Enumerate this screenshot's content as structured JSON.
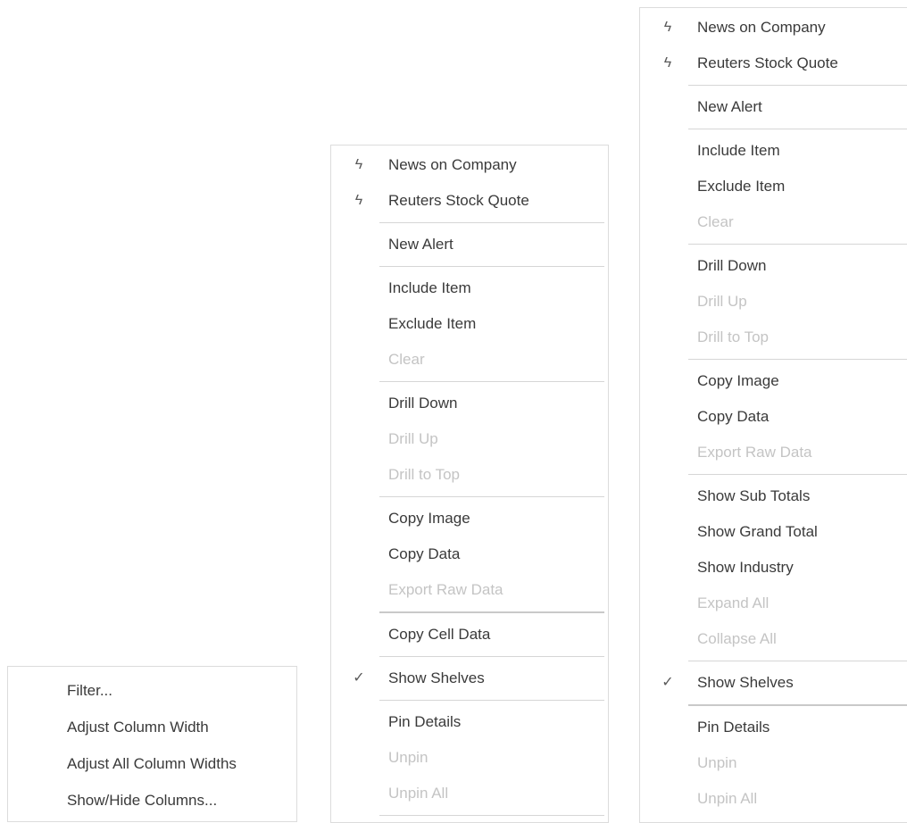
{
  "menus": {
    "left": {
      "items": [
        {
          "label": "Filter...",
          "disabled": false
        },
        {
          "label": "Adjust Column Width",
          "disabled": false
        },
        {
          "label": "Adjust All Column Widths",
          "disabled": false
        },
        {
          "label": "Show/Hide Columns...",
          "disabled": false
        }
      ]
    },
    "mid": {
      "items": [
        {
          "label": "News on Company",
          "icon": "bolt-icon",
          "disabled": false
        },
        {
          "label": "Reuters Stock Quote",
          "icon": "bolt-icon",
          "disabled": false
        },
        {
          "sep": true
        },
        {
          "label": "New Alert",
          "disabled": false
        },
        {
          "sep": true
        },
        {
          "label": "Include Item",
          "disabled": false
        },
        {
          "label": "Exclude Item",
          "disabled": false
        },
        {
          "label": "Clear",
          "disabled": true
        },
        {
          "sep": true
        },
        {
          "label": "Drill Down",
          "disabled": false
        },
        {
          "label": "Drill Up",
          "disabled": true
        },
        {
          "label": "Drill to Top",
          "disabled": true
        },
        {
          "sep": true
        },
        {
          "label": "Copy Image",
          "disabled": false
        },
        {
          "label": "Copy Data",
          "disabled": false
        },
        {
          "label": "Export Raw Data",
          "disabled": true
        },
        {
          "sep": true,
          "thick": true
        },
        {
          "label": "Copy Cell Data",
          "disabled": false
        },
        {
          "sep": true
        },
        {
          "label": "Show Shelves",
          "icon": "checkmark-icon",
          "disabled": false
        },
        {
          "sep": true
        },
        {
          "label": "Pin Details",
          "disabled": false
        },
        {
          "label": "Unpin",
          "disabled": true
        },
        {
          "label": "Unpin All",
          "disabled": true
        },
        {
          "sep": true
        }
      ]
    },
    "right": {
      "items": [
        {
          "label": "News on Company",
          "icon": "bolt-icon",
          "disabled": false
        },
        {
          "label": "Reuters Stock Quote",
          "icon": "bolt-icon",
          "disabled": false
        },
        {
          "sep": true
        },
        {
          "label": "New Alert",
          "disabled": false
        },
        {
          "sep": true
        },
        {
          "label": "Include Item",
          "disabled": false
        },
        {
          "label": "Exclude Item",
          "disabled": false
        },
        {
          "label": "Clear",
          "disabled": true
        },
        {
          "sep": true
        },
        {
          "label": "Drill Down",
          "disabled": false
        },
        {
          "label": "Drill Up",
          "disabled": true
        },
        {
          "label": "Drill to Top",
          "disabled": true
        },
        {
          "sep": true
        },
        {
          "label": "Copy Image",
          "disabled": false
        },
        {
          "label": "Copy Data",
          "disabled": false
        },
        {
          "label": "Export Raw Data",
          "disabled": true
        },
        {
          "sep": true
        },
        {
          "label": "Show Sub Totals",
          "disabled": false
        },
        {
          "label": "Show Grand Total",
          "disabled": false
        },
        {
          "label": "Show Industry",
          "disabled": false
        },
        {
          "label": "Expand All",
          "disabled": true
        },
        {
          "label": "Collapse All",
          "disabled": true
        },
        {
          "sep": true
        },
        {
          "label": "Show Shelves",
          "icon": "checkmark-icon",
          "disabled": false
        },
        {
          "sep": true,
          "thick": true
        },
        {
          "label": "Pin Details",
          "disabled": false
        },
        {
          "label": "Unpin",
          "disabled": true
        },
        {
          "label": "Unpin All",
          "disabled": true
        }
      ]
    }
  },
  "icons": {
    "bolt-icon": "ϟ",
    "checkmark-icon": "✓"
  },
  "colors": {
    "text": "#3a3a3a",
    "disabled_text": "#c4c4c4",
    "separator": "#d6d6d6",
    "border": "#dcdcdc"
  }
}
